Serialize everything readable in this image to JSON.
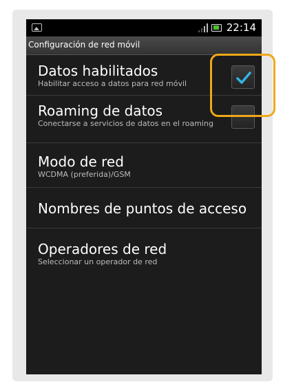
{
  "statusbar": {
    "time": "22:14"
  },
  "header": {
    "title": "Configuración de red móvil"
  },
  "settings": [
    {
      "label": "Datos habilitados",
      "summary": "Habilitar acceso a datos para red móvil",
      "checked": true
    },
    {
      "label": "Roaming de datos",
      "summary": "Conectarse a servicios de datos en el roaming",
      "checked": false
    },
    {
      "label": "Modo de red",
      "summary": "WCDMA (preferida)/GSM"
    },
    {
      "label": "Nombres de puntos de acceso",
      "summary": ""
    },
    {
      "label": "Operadores de red",
      "summary": "Seleccionar un operador de red"
    }
  ],
  "colors": {
    "highlight": "#f0a818",
    "check": "#33b5e5"
  }
}
